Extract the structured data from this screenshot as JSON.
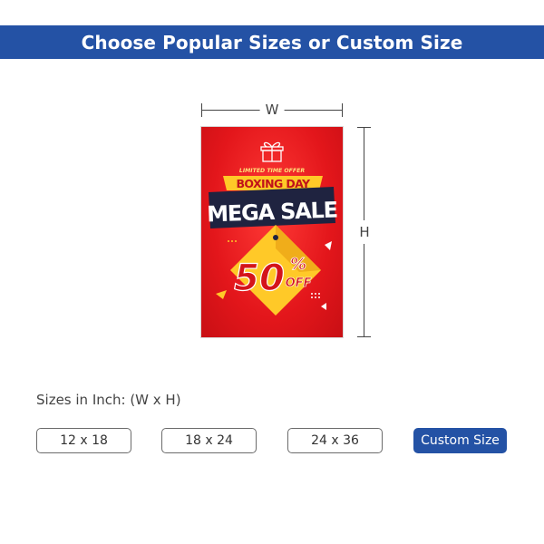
{
  "header": {
    "title": "Choose Popular Sizes or Custom Size"
  },
  "diagram": {
    "width_label": "W",
    "height_label": "H"
  },
  "poster": {
    "ribbon_text": "LIMITED TIME OFFER",
    "line1": "BOXING DAY",
    "line2": "MEGA SALE",
    "discount": "50",
    "percent": "%",
    "off": "OFF",
    "icon": "gift-icon"
  },
  "sizes": {
    "label": "Sizes in Inch: (W x H)",
    "options": [
      "12 x 18",
      "18 x 24",
      "24 x 36",
      "Custom Size"
    ],
    "selected": "Custom Size"
  },
  "colors": {
    "brand": "#2452a5",
    "poster_red": "#e3161b",
    "poster_yellow": "#ffc928",
    "poster_navy": "#1f2340"
  }
}
